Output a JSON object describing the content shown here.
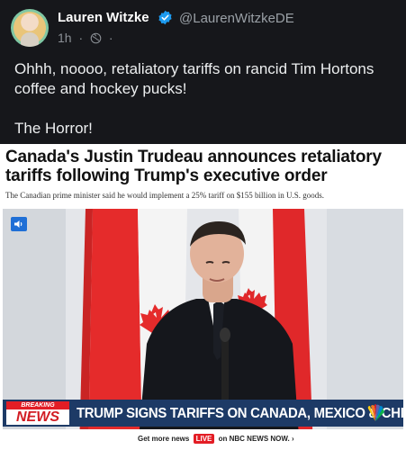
{
  "post": {
    "author_name": "Lauren Witzke",
    "handle": "@LaurenWitzkeDE",
    "time": "1h",
    "separator": "·",
    "body_line1": "Ohhh, noooo, retaliatory tariffs on rancid Tim Hortons coffee and hockey pucks!",
    "body_line2": "The Horror!"
  },
  "article": {
    "headline": "Canada's Justin Trudeau announces retaliatory tariffs following Trump's executive order",
    "subhead": "The Canadian prime minister said he would implement a 25% tariff on $155 billion in U.S. goods."
  },
  "video": {
    "breaking_top": "BREAKING",
    "breaking_bottom": "NEWS",
    "chyron": "TRUMP SIGNS TARIFFS ON CANADA, MEXICO & CHINA",
    "footer_prefix": "Get more news",
    "footer_live": "LIVE",
    "footer_on": "on",
    "footer_brand": "NBC NEWS NOW.",
    "footer_chevron": "›"
  },
  "colors": {
    "background": "#16171b",
    "verified": "#1d9bf0",
    "chyron": "#1d3a66",
    "breaking_red": "#e31d25"
  }
}
